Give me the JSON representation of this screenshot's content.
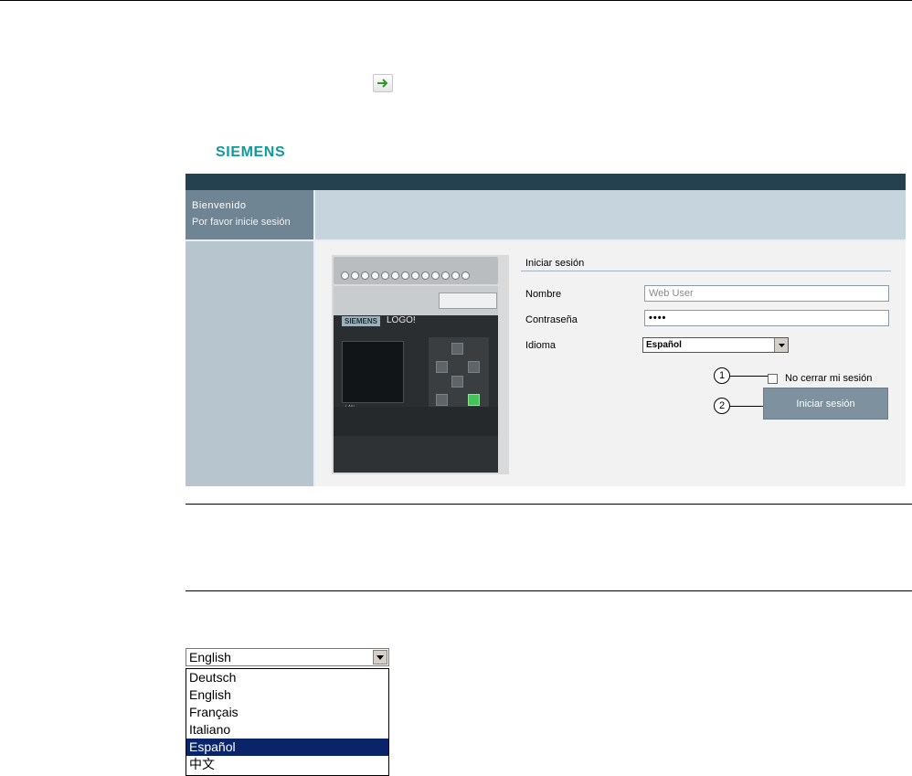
{
  "go_icon": "arrow-right-icon",
  "brand": "SIEMENS",
  "sidebar": {
    "welcome": "Bienvenido",
    "prompt": "Por favor inicie sesión"
  },
  "device": {
    "brand_badge": "SIEMENS",
    "model": "LOGO!",
    "lan_label": "LAN"
  },
  "login": {
    "title": "Iniciar sesión",
    "name_label": "Nombre",
    "name_placeholder": "Web User",
    "password_label": "Contraseña",
    "password_value": "••••",
    "language_label": "Idioma",
    "language_value": "Español",
    "keep_label": "No cerrar mi sesión",
    "submit_label": "Iniciar sesión"
  },
  "callouts": [
    "1",
    "2"
  ],
  "language_dropdown": {
    "selected": "English",
    "options": [
      "Deutsch",
      "English",
      "Français",
      "Italiano",
      "Español",
      "中文"
    ],
    "highlighted": "Español"
  },
  "colors": {
    "brand": "#0e9a9b",
    "topbar": "#25414f",
    "button": "#7d919e",
    "highlight": "#0a246a"
  }
}
